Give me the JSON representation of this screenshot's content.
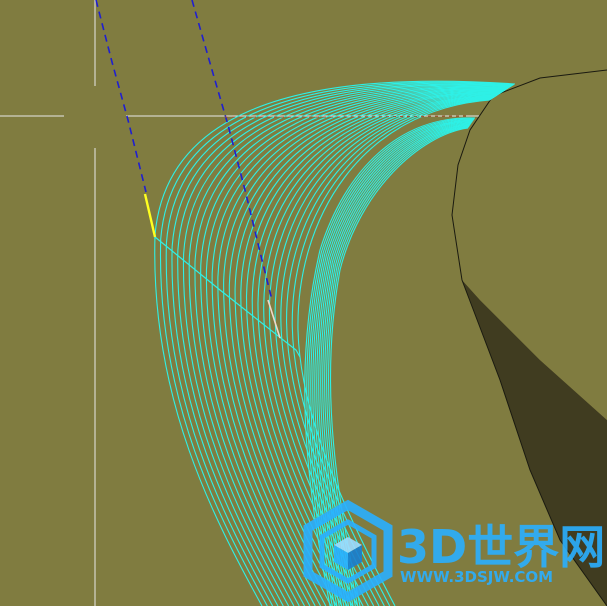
{
  "viewport": {
    "background_color": "#807c40",
    "toolpath_color": "#2ef0e6",
    "solid_face_color": "#807c40",
    "solid_shadow_color": "#403c20",
    "solid_edge_color": "#1a1a10",
    "crosshair_color": "#e8e8e8",
    "guide_line_color": "#1f1fd0",
    "highlight_segment_color": "#ffff20",
    "tool_marker_color": "#f0d8c8"
  },
  "watermark": {
    "brand": "3D世界网",
    "url": "WWW.3DSJW.COM",
    "logo_icon": "cube-hexagon-icon",
    "color": "#2ab0ff"
  }
}
